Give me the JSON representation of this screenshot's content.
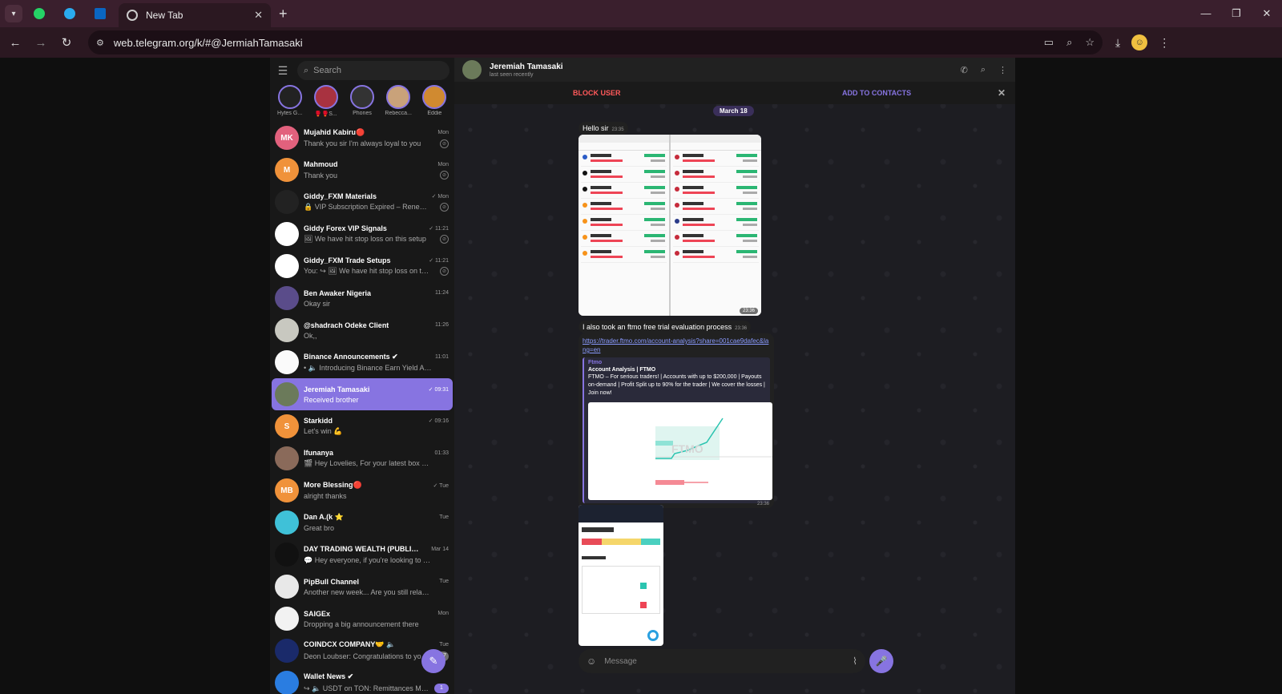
{
  "browser": {
    "pinned_tabs": [
      {
        "icon": "whatsapp-icon",
        "color": "#25d366"
      },
      {
        "icon": "telegram-icon",
        "color": "#2aabee"
      },
      {
        "icon": "linkedin-icon",
        "color": "#0a66c2"
      }
    ],
    "active_tab": {
      "title": "New Tab"
    },
    "url": "web.telegram.org/k/#@JermiahTamasaki"
  },
  "sidebar": {
    "search_placeholder": "Search",
    "stories": [
      {
        "name": "Hytes G..."
      },
      {
        "name": "🥊🥊S..."
      },
      {
        "name": "Phones"
      },
      {
        "name": "Rebecca..."
      },
      {
        "name": "Eddie"
      }
    ],
    "chats": [
      {
        "name": "Mujahid Kabiru🔴",
        "time": "Mon",
        "preview": "Thank you sir I'm always loyal to you",
        "initials": "MK",
        "color": "#e2617d",
        "pinned": true,
        "unread": ""
      },
      {
        "name": "Mahmoud",
        "time": "Mon",
        "preview": "Thank you",
        "initials": "M",
        "color": "#f0923a",
        "pinned": true,
        "unread": ""
      },
      {
        "name": "Giddy_FXM Materials",
        "time": "✓ Mon",
        "preview": "🔒 VIP Subscription Expired – Renew N...",
        "initials": "",
        "color": "#222222",
        "pinned": true,
        "unread": ""
      },
      {
        "name": "Giddy Forex VIP Signals",
        "time": "✓ 11:21",
        "preview": "🖼 We have hit stop loss on this setup",
        "initials": "",
        "color": "#ffffff",
        "pinned": true,
        "unread": ""
      },
      {
        "name": "Giddy_FXM Trade Setups",
        "time": "✓ 11:21",
        "preview": "You: ↪ 🖼 We have hit stop loss on this...",
        "initials": "",
        "color": "#ffffff",
        "pinned": true,
        "unread": ""
      },
      {
        "name": "Ben Awaker Nigeria",
        "time": "11:24",
        "preview": "Okay sir",
        "initials": "",
        "color": "#5a4c8a",
        "pinned": false,
        "unread": ""
      },
      {
        "name": "@shadrach Odeke Client",
        "time": "11:26",
        "preview": "Ok,,",
        "initials": "",
        "color": "#c8c8c0",
        "pinned": false,
        "unread": ""
      },
      {
        "name": "Binance Announcements ✔",
        "time": "11:01",
        "preview": "• 🔈 Introducing Binance Earn Yield Arena wi...",
        "initials": "",
        "color": "#fafafa",
        "pinned": false,
        "unread": ""
      },
      {
        "name": "Jeremiah Tamasaki",
        "time": "✓ 09:31",
        "preview": "Received brother",
        "initials": "",
        "color": "#6b7a5a",
        "pinned": false,
        "unread": "",
        "active": true
      },
      {
        "name": "Starkidd",
        "time": "✓ 09:16",
        "preview": "Let's win 💪",
        "initials": "S",
        "color": "#f0923a",
        "pinned": false,
        "unread": ""
      },
      {
        "name": "Ifunanya",
        "time": "01:33",
        "preview": "🎬 Hey Lovelies, For your latest box office ...",
        "initials": "",
        "color": "#8a6a5a",
        "pinned": false,
        "unread": ""
      },
      {
        "name": "More Blessing🔴",
        "time": "✓ Tue",
        "preview": "alright thanks",
        "initials": "MB",
        "color": "#f0923a",
        "pinned": false,
        "unread": ""
      },
      {
        "name": "Dan A.(k ⭐",
        "time": "Tue",
        "preview": "Great bro",
        "initials": "",
        "color": "#3fc1d8",
        "pinned": false,
        "unread": ""
      },
      {
        "name": "DAY TRADING WEALTH (PUBLIC) 🔈",
        "time": "Mar 14",
        "preview": "💬 Hey everyone, if you're looking to get fu...",
        "initials": "",
        "color": "#111111",
        "pinned": false,
        "unread": ""
      },
      {
        "name": "PipBull Channel",
        "time": "Tue",
        "preview": "Another new week... Are you still relaxed? ...",
        "initials": "",
        "color": "#e8e8e8",
        "pinned": false,
        "unread": ""
      },
      {
        "name": "SAIGEx",
        "time": "Mon",
        "preview": "Dropping a big announcement there",
        "initials": "",
        "color": "#f2f2f2",
        "pinned": false,
        "unread": ""
      },
      {
        "name": "COINDCX COMPANY🤝 🔈",
        "time": "Tue",
        "preview": "Deon Loubser: Congratulations to yo...",
        "initials": "",
        "color": "#1a2a6a",
        "pinned": false,
        "unread": "387"
      },
      {
        "name": "Wallet News ✔",
        "time": "",
        "preview": "↪ 🔈 USDT on TON: Remittances Mad...",
        "initials": "",
        "color": "#2a7de1",
        "pinned": false,
        "unread": "1"
      }
    ]
  },
  "chat": {
    "name": "Jeremiah Tamasaki",
    "status": "last seen recently",
    "block_label": "BLOCK USER",
    "add_label": "ADD TO CONTACTS",
    "date_label": "March 18",
    "messages": {
      "m1": {
        "text": "Hello sir",
        "time": "23:35"
      },
      "img1": {
        "time": "23:36"
      },
      "m2": {
        "text": "I also took an ftmo free trial evaluation process",
        "time": "23:36"
      },
      "link": {
        "url": "https://trader.ftmo.com/account-analysis?share=001cae9dafec&lang=en",
        "site": "Ftmo",
        "title": "Account Analysis | FTMO",
        "description": "FTMO – For serious traders! | Accounts with up to $200,000 | Payouts on-demand | Profit Split up to 90% for the trader | We cover the losses | Join now!",
        "time": "23:36",
        "chart_watermark": "FTMO"
      }
    },
    "composer_placeholder": "Message"
  },
  "colors": {
    "accent": "#8774e1",
    "danger": "#ff595a"
  }
}
